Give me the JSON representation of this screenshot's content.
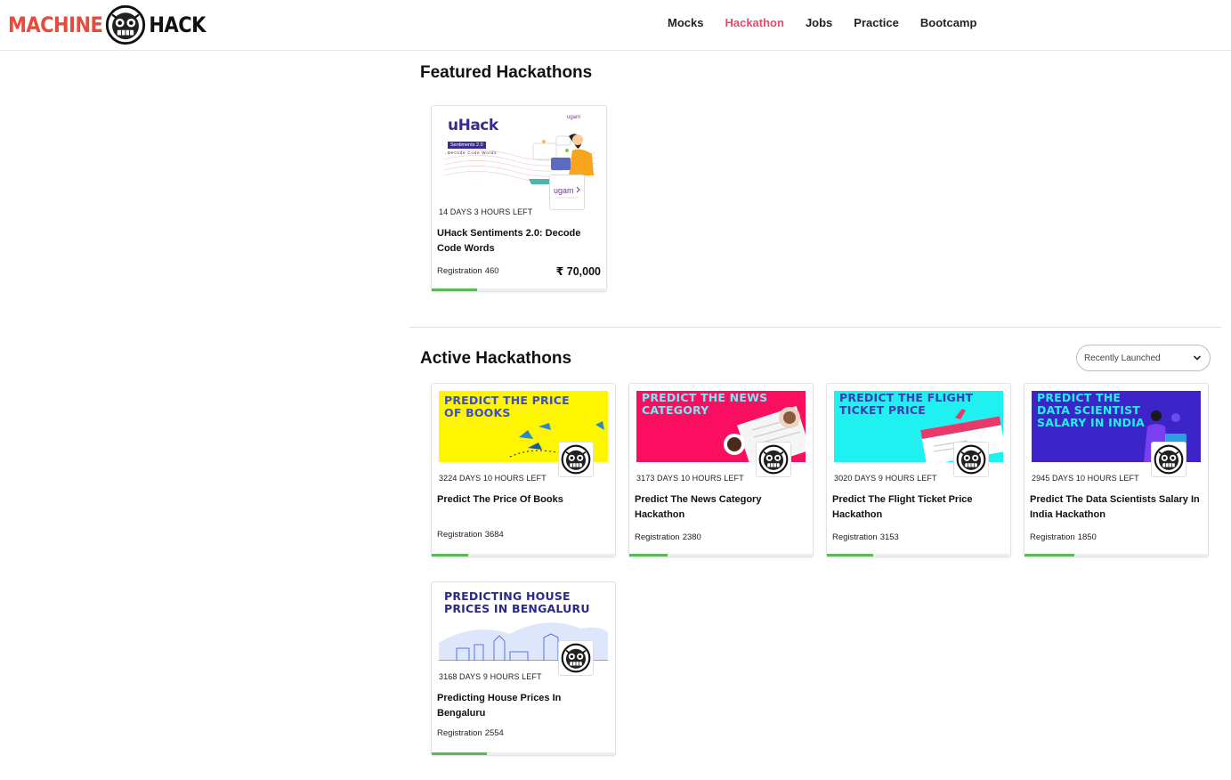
{
  "header": {
    "logo_left": "MACHINE",
    "logo_right": "HACK",
    "nav": [
      {
        "label": "Mocks",
        "active": false
      },
      {
        "label": "Hackathon",
        "active": true
      },
      {
        "label": "Jobs",
        "active": false
      },
      {
        "label": "Practice",
        "active": false
      },
      {
        "label": "Bootcamp",
        "active": false
      }
    ]
  },
  "featured": {
    "title": "Featured Hackathons",
    "card": {
      "banner_text": "uHack",
      "banner_sub": "Sentiments 2.0",
      "banner_sub2": "Decode Code Words",
      "sponsor": "ugam",
      "time_left": "14 DAYS 3 HOURS LEFT",
      "title": "UHack Sentiments 2.0: Decode Code Words",
      "registration_label": "Registration",
      "registration_count": "460",
      "prize": "₹ 70,000",
      "progress": 0.26
    }
  },
  "active": {
    "title": "Active Hackathons",
    "sort_selected": "Recently Launched",
    "cards": [
      {
        "banner_text": "Predict the price of books",
        "time_left": "3224 DAYS 10 HOURS LEFT",
        "title": "Predict The Price Of Books",
        "registration_label": "Registration",
        "registration_count": "3684",
        "progress": 0.2
      },
      {
        "banner_text": "Predict the news category",
        "time_left": "3173 DAYS 10 HOURS LEFT",
        "title": "Predict The News Category Hackathon",
        "registration_label": "Registration",
        "registration_count": "2380",
        "progress": 0.21
      },
      {
        "banner_text": "Predict the flight ticket price",
        "time_left": "3020 DAYS 9 HOURS LEFT",
        "title": "Predict The Flight Ticket Price Hackathon",
        "registration_label": "Registration",
        "registration_count": "3153",
        "progress": 0.25
      },
      {
        "banner_text": "Predict the data scientist salary in India",
        "time_left": "2945 DAYS 10 HOURS LEFT",
        "title": "Predict The Data Scientists Salary In India Hackathon",
        "registration_label": "Registration",
        "registration_count": "1850",
        "progress": 0.27
      },
      {
        "banner_text": "Predicting house prices in Bengaluru",
        "time_left": "3168 DAYS 9 HOURS LEFT",
        "title": "Predicting House Prices In Bengaluru",
        "registration_label": "Registration",
        "registration_count": "2554",
        "progress": 0.3
      }
    ]
  },
  "colors": {
    "accent": "#e64b6a",
    "logo_red": "#e64b3c",
    "progress": "#5cb85c",
    "books_banner": "#fef600",
    "news_banner": "#fb0e5f",
    "flight_banner": "#1ff0f0",
    "salary_banner": "#3c24c8",
    "house_banner": "#ffffff"
  }
}
